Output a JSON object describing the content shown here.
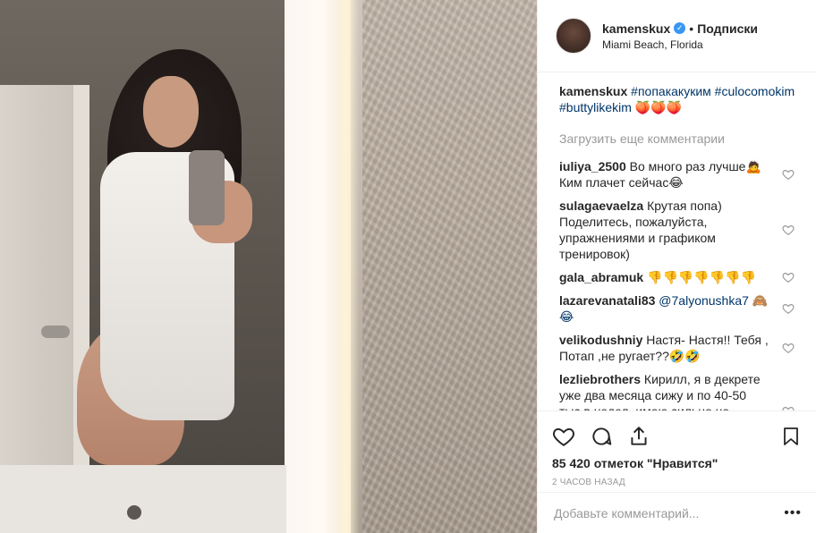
{
  "post": {
    "username": "kamenskux",
    "verified_icon": "verified-icon",
    "separator": "•",
    "follow_label": "Подписки",
    "location": "Miami Beach, Florida"
  },
  "caption": {
    "user": "kamenskux",
    "text": "#попакакуким #culocomokim #buttylikekim 🍑🍑🍑"
  },
  "load_more": "Загрузить еще комментарии",
  "comments": [
    {
      "user": "iuliya_2500",
      "text": "Во много раз лучше🙇 Ким плачет сейчас😂"
    },
    {
      "user": "sulagaevaelza",
      "text": "Крутая попа) Поделитесь, пожалуйста, упражнениями и графиком тренировок)"
    },
    {
      "user": "gala_abramuk",
      "text": "👎👎👎👎👎👎👎"
    },
    {
      "user": "lazarevanatali83",
      "text": "@7alyonushka7 🙈😂"
    },
    {
      "user": "velikodushniy",
      "text": "Настя- Настя!! Тебя , Потап ,не ругает??🤣🤣"
    },
    {
      "user": "lezliebrothers",
      "text": "Кирилл, я в декрете уже два месяца сижу и по 40-50 тыс в недел. имею сильно не заморачиваясь и тебе советую!Если"
    }
  ],
  "likes_text": "85 420 отметок \"Нравится\"",
  "time_text": "2 ЧАСОВ НАЗАД",
  "comment_input": {
    "placeholder": "Добавьте комментарий...",
    "more_icon": "•••"
  },
  "colors": {
    "link": "#003569",
    "verified": "#3897f0",
    "muted": "#999999"
  }
}
